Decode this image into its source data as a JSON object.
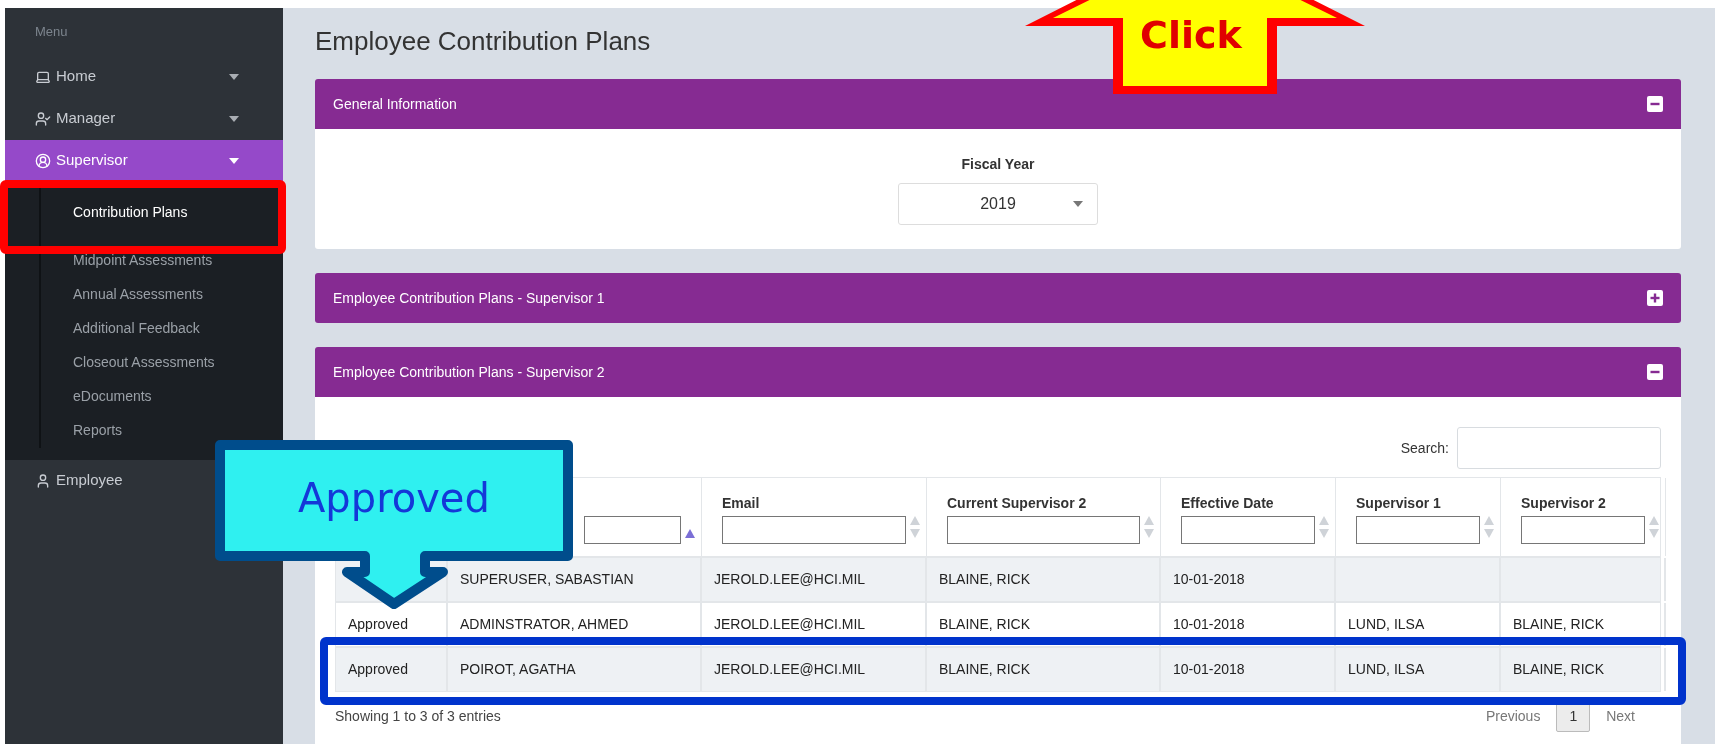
{
  "sidebar": {
    "heading": "Menu",
    "items": [
      {
        "label": "Home",
        "expanded": false,
        "selected": false,
        "has_caret": true
      },
      {
        "label": "Manager",
        "expanded": false,
        "selected": false,
        "has_caret": true
      },
      {
        "label": "Supervisor",
        "expanded": true,
        "selected": true,
        "has_caret": true,
        "children": [
          {
            "label": "Contribution Plans",
            "selected": true
          },
          {
            "label": "Midpoint Assessments",
            "selected": false
          },
          {
            "label": "Annual Assessments",
            "selected": false
          },
          {
            "label": "Additional Feedback",
            "selected": false
          },
          {
            "label": "Closeout Assessments",
            "selected": false
          },
          {
            "label": "eDocuments",
            "selected": false
          },
          {
            "label": "Reports",
            "selected": false
          }
        ]
      },
      {
        "label": "Employee",
        "expanded": false,
        "selected": false,
        "has_caret": false
      }
    ]
  },
  "page_title": "Employee Contribution Plans",
  "panels": [
    {
      "title": "General Information",
      "expanded": true,
      "kind": "fiscal",
      "field_label": "Fiscal Year",
      "field_value": "2019"
    },
    {
      "title": "Employee Contribution Plans - Supervisor 1",
      "expanded": false
    },
    {
      "title": "Employee Contribution Plans - Supervisor 2",
      "expanded": true,
      "kind": "table"
    }
  ],
  "table": {
    "search_label": "Search:",
    "columns": [
      {},
      {
        "sorted": true
      },
      {
        "label": "Email",
        "sorted": false
      },
      {
        "label": "Current Supervisor 2",
        "sorted": false
      },
      {
        "label": "Effective Date",
        "sorted": false
      },
      {
        "label": "Supervisor 1",
        "sorted": false
      },
      {
        "label": "Supervisor 2",
        "sorted": false
      }
    ],
    "rows": [
      {
        "cells": [
          null,
          "SUPERUSER, SABASTIAN",
          "JEROLD.LEE@HCI.MIL",
          "BLAINE, RICK",
          "10-01-2018",
          null,
          null
        ]
      },
      {
        "cells": [
          "Approved",
          "ADMINSTRATOR, AHMED",
          "JEROLD.LEE@HCI.MIL",
          "BLAINE, RICK",
          "10-01-2018",
          "LUND, ILSA",
          "BLAINE, RICK"
        ]
      },
      {
        "cells": [
          "Approved",
          "POIROT, AGATHA",
          "JEROLD.LEE@HCI.MIL",
          "BLAINE, RICK",
          "10-01-2018",
          "LUND, ILSA",
          "BLAINE, RICK"
        ]
      }
    ],
    "info": "Showing 1 to 3 of 3 entries",
    "pagination": [
      {
        "label": "Previous",
        "kind": "link",
        "selected": false
      },
      {
        "label": "1",
        "kind": "page",
        "selected": true
      },
      {
        "label": "Next",
        "kind": "link",
        "selected": false
      }
    ]
  },
  "annotations": [
    {
      "kind": "up-arrow",
      "text": "Click"
    },
    {
      "kind": "down-callout",
      "text": "Approved"
    },
    {
      "kind": "frame",
      "color": "#ff0000"
    },
    {
      "kind": "frame",
      "color": "#0033cc"
    }
  ]
}
